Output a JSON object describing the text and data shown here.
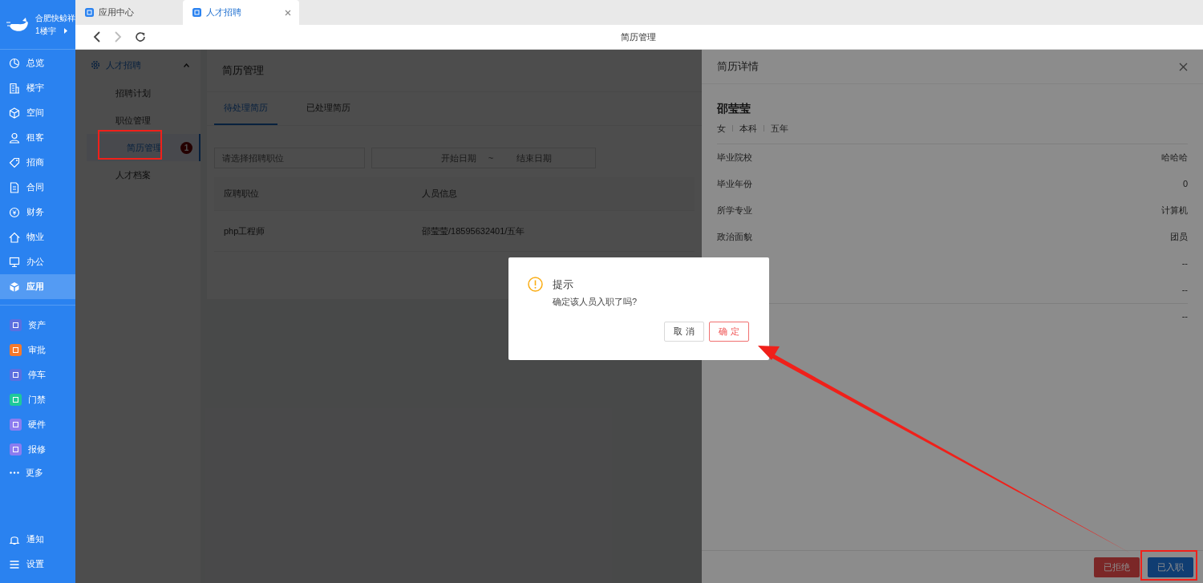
{
  "sidebar": {
    "brand": "合肥快鲸祥",
    "building": "1楼宇",
    "nav_items": [
      {
        "label": "总览",
        "selected": false
      },
      {
        "label": "楼宇",
        "selected": false
      },
      {
        "label": "空间",
        "selected": false
      },
      {
        "label": "租客",
        "selected": false
      },
      {
        "label": "招商",
        "selected": false
      },
      {
        "label": "合同",
        "selected": false
      },
      {
        "label": "财务",
        "selected": false
      },
      {
        "label": "物业",
        "selected": false
      },
      {
        "label": "办公",
        "selected": false
      },
      {
        "label": "应用",
        "selected": true
      }
    ],
    "app_items": [
      {
        "label": "资产",
        "color": "#5b6fe0"
      },
      {
        "label": "审批",
        "color": "#f5792b"
      },
      {
        "label": "停车",
        "color": "#5b6fe0"
      },
      {
        "label": "门禁",
        "color": "#1ec99a"
      },
      {
        "label": "硬件",
        "color": "#8c7cf0"
      },
      {
        "label": "报修",
        "color": "#8c7cf0"
      }
    ],
    "more": "更多",
    "bottom_items": [
      {
        "label": "通知"
      },
      {
        "label": "设置"
      }
    ]
  },
  "tabs": [
    {
      "label": "应用中心",
      "selected": false
    },
    {
      "label": "人才招聘",
      "selected": true
    }
  ],
  "toolbar": {
    "title": "简历管理"
  },
  "submenu": {
    "title": "人才招聘",
    "expanded": true,
    "items": [
      {
        "label": "招聘计划",
        "selected": false
      },
      {
        "label": "职位管理",
        "selected": false
      },
      {
        "label": "简历管理",
        "selected": true,
        "badge": "1"
      },
      {
        "label": "人才档案",
        "selected": false
      }
    ]
  },
  "card": {
    "title": "简历管理",
    "tabs": [
      {
        "label": "待处理简历",
        "selected": true
      },
      {
        "label": "已处理简历",
        "selected": false
      }
    ],
    "filters": {
      "position_placeholder": "请选择招聘职位",
      "start_placeholder": "开始日期",
      "separator": "~",
      "end_placeholder": "结束日期"
    },
    "table": {
      "columns": [
        "应聘职位",
        "人员信息"
      ],
      "rows": [
        [
          "php工程师",
          "邵莹莹/18595632401/五年"
        ]
      ]
    }
  },
  "drawer": {
    "title": "简历详情",
    "name": "邵莹莹",
    "tags": [
      "女",
      "本科",
      "五年"
    ],
    "fields": [
      {
        "label": "毕业院校",
        "value": "哈哈哈"
      },
      {
        "label": "毕业年份",
        "value": "0"
      },
      {
        "label": "所学专业",
        "value": "计算机"
      },
      {
        "label": "政治面貌",
        "value": "团员"
      },
      {
        "value": "--"
      },
      {
        "value": "--"
      },
      {
        "value": "--",
        "divider_above": true
      }
    ],
    "buttons": [
      {
        "label": "已拒绝",
        "kind": "danger"
      },
      {
        "label": "已入职",
        "kind": "primary"
      }
    ]
  },
  "modal": {
    "title": "提示",
    "message": "确定该人员入职了吗?",
    "buttons": [
      {
        "label": "取 消",
        "kind": "default"
      },
      {
        "label": "确 定",
        "kind": "danger"
      }
    ]
  }
}
